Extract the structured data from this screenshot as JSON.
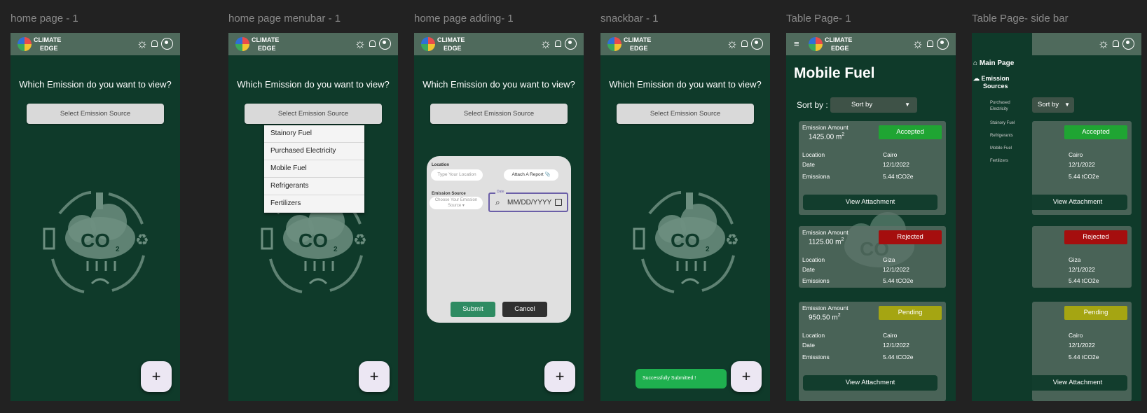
{
  "brand": {
    "line1": "CLIMATE",
    "line2": "EDGE"
  },
  "frames": [
    {
      "title": "home page - 1"
    },
    {
      "title": "home page menubar - 1"
    },
    {
      "title": "home page adding- 1"
    },
    {
      "title": "snackbar - 1"
    },
    {
      "title": "Table Page- 1"
    },
    {
      "title": "Table Page- side bar"
    }
  ],
  "home": {
    "question": "Which Emission do you want to view?",
    "select_label": "Select Emission Source",
    "fab": "+"
  },
  "menu": {
    "options": [
      "Stainory Fuel",
      "Purchased Electricity",
      "Mobile Fuel",
      "Refrigerants",
      "Fertilizers"
    ]
  },
  "dialog": {
    "location_label": "Location",
    "location_placeholder": "Type Your Location",
    "attach_label": "Attach A Report",
    "source_label": "Emission Source",
    "source_placeholder": "Choose Your Emission Source",
    "date_label": "Date",
    "date_placeholder": "MM/DD/YYYY",
    "submit": "Submit",
    "cancel": "Cancel"
  },
  "snackbar": {
    "message": "Successfully Submitted !"
  },
  "table": {
    "page_title": "Mobile Fuel",
    "sort_label": "Sort by :",
    "sort_button": "Sort by",
    "emission_amount_label": "Emission Amount",
    "location_label": "Location",
    "date_label": "Date",
    "cards": [
      {
        "amount": "1425.00 m",
        "status": "Accepted",
        "status_color": "#1fa533",
        "location": "Cairo",
        "date": "12/1/2022",
        "emissions_label": "Emissiona",
        "emissions": "5.44 tCO2e",
        "attachment": "View Attachment"
      },
      {
        "amount": "1125.00 m",
        "status": "Rejected",
        "status_color": "#a50e0e",
        "location": "Giza",
        "date": "12/1/2022",
        "emissions_label": "Emissions",
        "emissions": "5.44 tCO2e",
        "attachment": ""
      },
      {
        "amount": "950.50  m",
        "status": "Pending",
        "status_color": "#a5a512",
        "location": "Cairo",
        "date": "12/1/2022",
        "emissions_label": "Emissions",
        "emissions": "5.44 tCO2e",
        "attachment": "View Attachment"
      }
    ]
  },
  "sidebar": {
    "main": "Main Page",
    "emission_line1": "Emission",
    "emission_line2": "Sources",
    "items": [
      "Purchased Electricity",
      "Stainory Fuel",
      "Refrigerants",
      "Mobile Fuel",
      "Fertilizers"
    ]
  },
  "icons": {
    "sun": "sun-icon",
    "bell": "bell-icon",
    "account": "account-icon",
    "menu": "menu-icon"
  }
}
